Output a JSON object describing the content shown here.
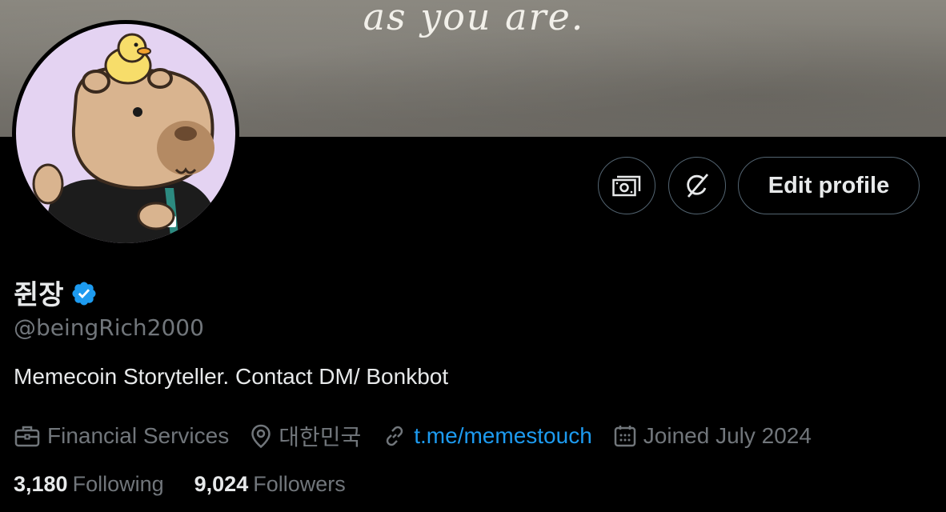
{
  "banner": {
    "text": "as you are."
  },
  "actions": {
    "tip_icon": "money-icon",
    "connect_icon": "grok-icon",
    "edit_profile_label": "Edit profile"
  },
  "profile": {
    "display_name": "쥔장",
    "handle": "@beingRich2000",
    "bio": "Memecoin Storyteller. Contact DM/ Bonkbot",
    "verified": true,
    "category": "Financial Services",
    "location": "대한민국",
    "website": "t.me/memestouch",
    "joined": "Joined July 2024"
  },
  "stats": {
    "following_count": "3,180",
    "following_label": "Following",
    "followers_count": "9,024",
    "followers_label": "Followers"
  },
  "colors": {
    "background": "#000000",
    "primary_text": "#e7e9ea",
    "secondary_text": "#71767b",
    "link": "#1d9bf0",
    "verified_badge": "#1d9bf0",
    "button_border": "#536471"
  }
}
